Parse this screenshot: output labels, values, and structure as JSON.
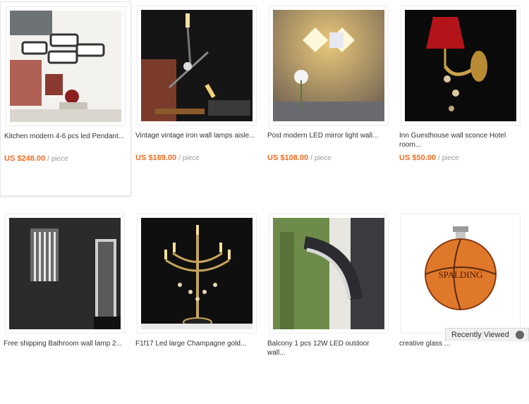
{
  "products": [
    {
      "title": "Kitchen modern 4-6 pcs led Pendant...",
      "price": "US $248.00",
      "unit": "/ piece"
    },
    {
      "title": "Vintage vintage iron wall lamps aisle...",
      "price": "US $189.00",
      "unit": "/ piece"
    },
    {
      "title": "Post modern LED mirror light wall...",
      "price": "US $108.00",
      "unit": "/ piece"
    },
    {
      "title": "Inn Guesthouse wall sconce Hotel room...",
      "price": "US $50.00",
      "unit": "/ piece"
    },
    {
      "title": "Free shipping Bathroom wall lamp 2..."
    },
    {
      "title": "F1f17 Led large Champagne gold..."
    },
    {
      "title": "Balcony 1 pcs 12W LED outdoor wall..."
    },
    {
      "title": "creative glass ..."
    }
  ],
  "recently_viewed": {
    "label": "Recently Viewed"
  },
  "colors": {
    "price": "#f36c21",
    "unit": "#999999"
  }
}
